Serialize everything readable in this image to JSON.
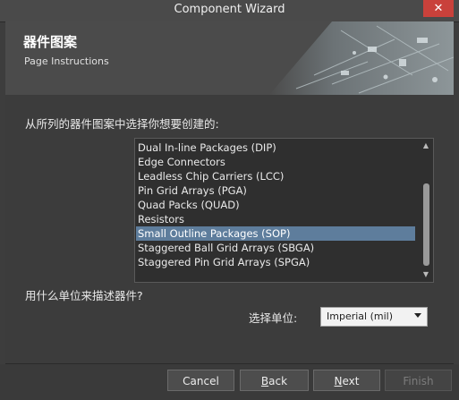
{
  "window": {
    "title": "Component Wizard",
    "close_glyph": "✕"
  },
  "header": {
    "title": "器件图案",
    "subtitle": "Page Instructions"
  },
  "content": {
    "prompt_pattern": "从所列的器件图案中选择你想要创建的:",
    "patterns": [
      "Dual In-line Packages (DIP)",
      "Edge Connectors",
      "Leadless Chip Carriers (LCC)",
      "Pin Grid Arrays (PGA)",
      "Quad Packs (QUAD)",
      "Resistors",
      "Small Outline Packages (SOP)",
      "Staggered Ball Grid Arrays (SBGA)",
      "Staggered Pin Grid Arrays (SPGA)"
    ],
    "selected_pattern": "Small Outline Packages (SOP)",
    "prompt_unit": "用什么单位来描述器件?",
    "unit_label": "选择单位:",
    "unit_value": "Imperial (mil)"
  },
  "footer": {
    "cancel": "Cancel",
    "back_first": "B",
    "back_rest": "ack",
    "next_first": "N",
    "next_rest": "ext",
    "finish": "Finish"
  },
  "colors": {
    "selection": "#5e7d9c",
    "close": "#c9413b"
  }
}
